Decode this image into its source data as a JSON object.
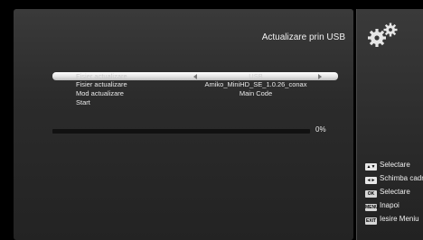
{
  "header": {
    "title": "Actualizare prin USB"
  },
  "menu": {
    "items": [
      {
        "label": "Fisier actualizare",
        "value": "USB",
        "selected": true
      },
      {
        "label": "Fisier actualizare",
        "value": "Amiko_MiniHD_SE_1.0.26_conax",
        "selected": false
      },
      {
        "label": "Mod actualizare",
        "value": "Main Code",
        "selected": false
      },
      {
        "label": "Start",
        "value": "",
        "selected": false
      }
    ]
  },
  "progress": {
    "percent_label": "0%",
    "value": 0
  },
  "help": {
    "items": [
      {
        "key": "▲▼",
        "label": "Selectare"
      },
      {
        "key": "◄►",
        "label": "Schimba cadru"
      },
      {
        "key": "OK",
        "label": "Selectare"
      },
      {
        "key": "MENU",
        "label": "Inapoi"
      },
      {
        "key": "EXIT",
        "label": "Iesire Meniu"
      }
    ]
  },
  "icons": {
    "settings": "gear-icon"
  },
  "colors": {
    "panel": "#2f2f2f",
    "highlight": "#ffffff",
    "text": "#f0f0f0"
  }
}
